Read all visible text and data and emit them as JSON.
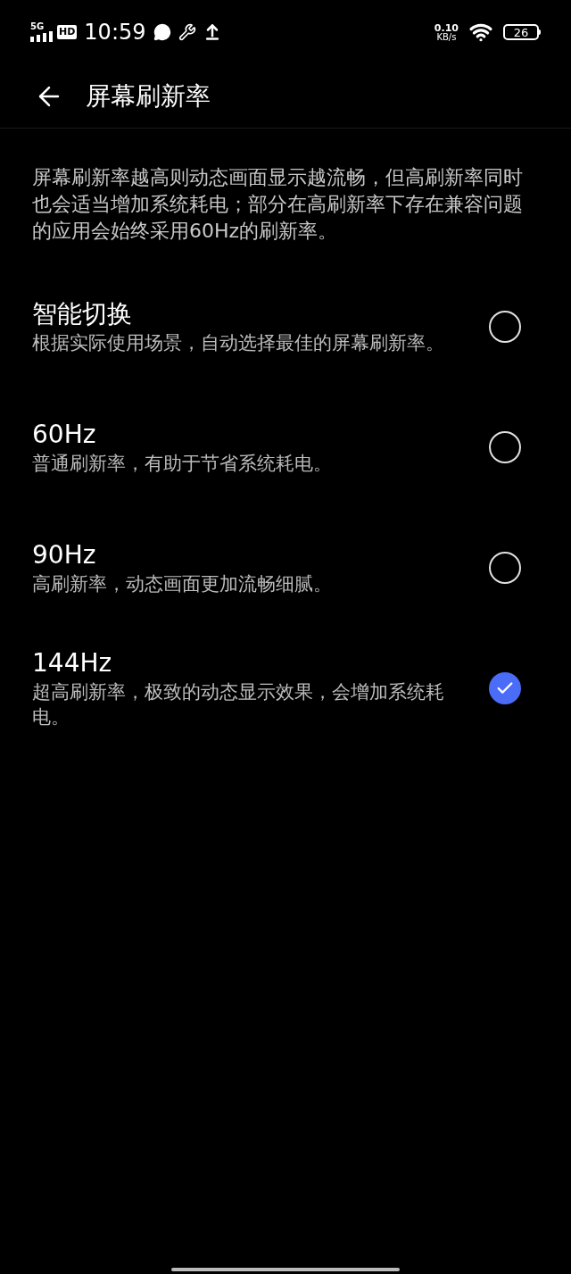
{
  "status_bar": {
    "network": "5G",
    "hd": "HD",
    "time": "10:59",
    "speed_value": "0.10",
    "speed_unit": "KB/s",
    "battery": "26"
  },
  "header": {
    "title": "屏幕刷新率"
  },
  "description": "屏幕刷新率越高则动态画面显示越流畅，但高刷新率同时也会适当增加系统耗电；部分在高刷新率下存在兼容问题的应用会始终采用60Hz的刷新率。",
  "options": [
    {
      "title": "智能切换",
      "subtitle": "根据实际使用场景，自动选择最佳的屏幕刷新率。",
      "selected": false
    },
    {
      "title": "60Hz",
      "subtitle": "普通刷新率，有助于节省系统耗电。",
      "selected": false
    },
    {
      "title": "90Hz",
      "subtitle": "高刷新率，动态画面更加流畅细腻。",
      "selected": false
    },
    {
      "title": "144Hz",
      "subtitle": "超高刷新率，极致的动态显示效果，会增加系统耗电。",
      "selected": true
    }
  ]
}
